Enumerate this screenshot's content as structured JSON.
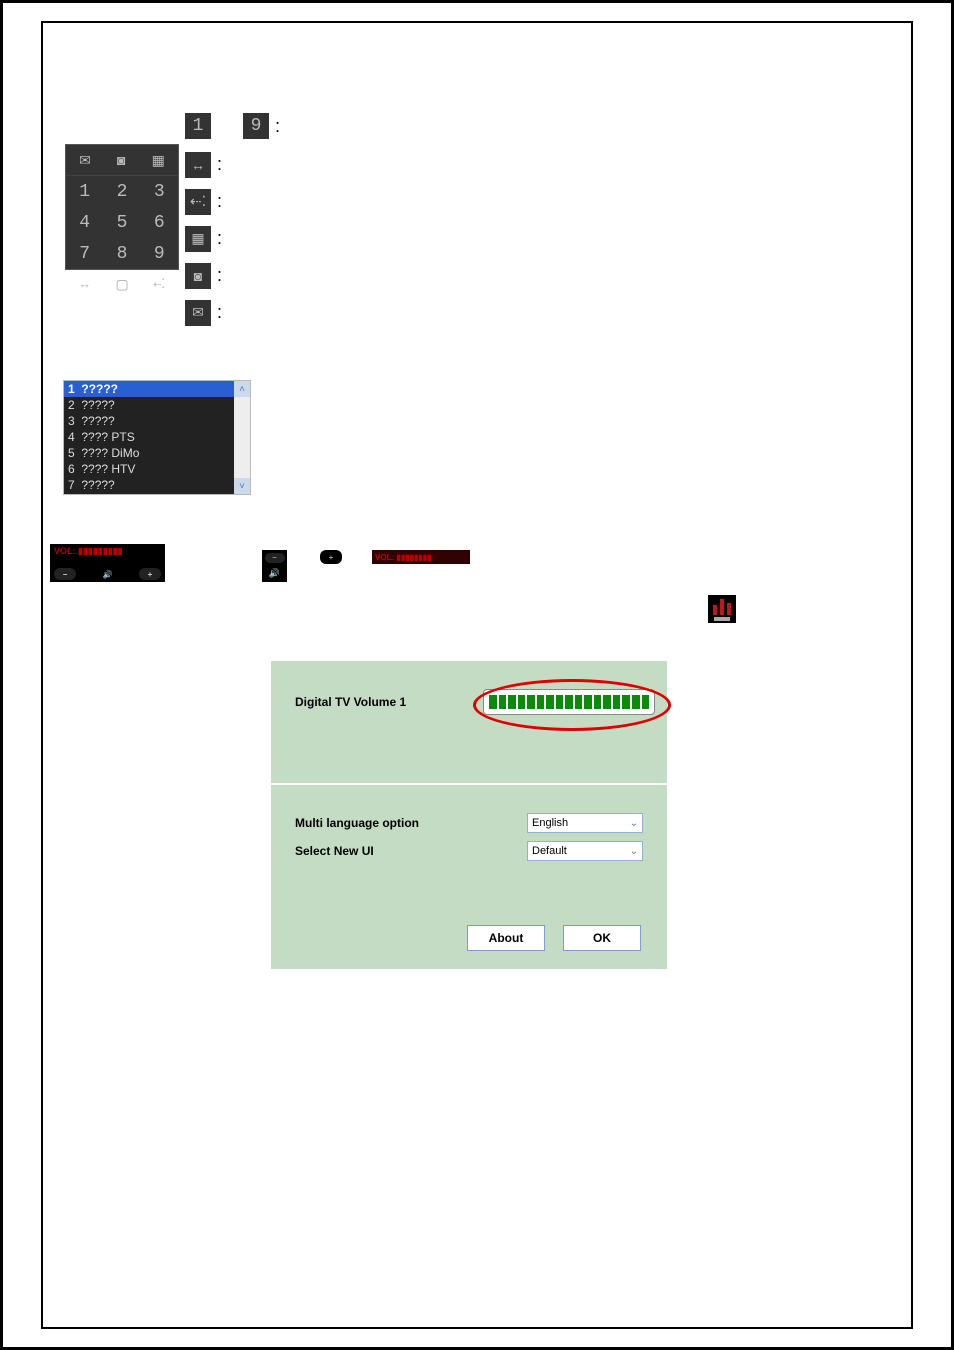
{
  "icons": {
    "first_colon": ":",
    "row_colon": ":"
  },
  "remote": {
    "keys": [
      "1",
      "2",
      "3",
      "4",
      "5",
      "6",
      "7",
      "8",
      "9",
      "↔",
      "▢",
      "⇠⁚"
    ]
  },
  "channels": {
    "items": [
      {
        "n": "1",
        "t": "?????"
      },
      {
        "n": "2",
        "t": "?????"
      },
      {
        "n": "3",
        "t": "?????"
      },
      {
        "n": "4",
        "t": "???? PTS"
      },
      {
        "n": "5",
        "t": "???? DiMo"
      },
      {
        "n": "6",
        "t": "???? HTV"
      },
      {
        "n": "7",
        "t": "?????"
      }
    ]
  },
  "volume_strip": {
    "label": "VOL:  ▮▮▮▮▮▮▮▮▮"
  },
  "vol_indicator": "VOL:  ▮▮▮▮▮▮▮▮",
  "dialog": {
    "vol_label": "Digital TV Volume 1",
    "lang_label": "Multi language option",
    "lang_value": "English",
    "ui_label": "Select New UI",
    "ui_value": "Default",
    "about": "About",
    "ok": "OK"
  }
}
